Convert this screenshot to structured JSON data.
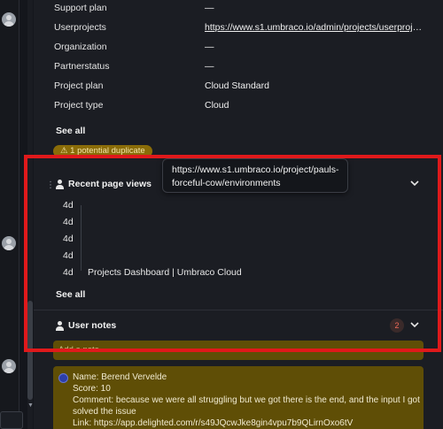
{
  "details": {
    "rows": [
      {
        "label": "Support plan",
        "value": "—"
      },
      {
        "label": "Userprojects",
        "value": "https://www.s1.umbraco.io/admin/projects/userprojects..."
      },
      {
        "label": "Organization",
        "value": "—"
      },
      {
        "label": "Partnerstatus",
        "value": "—"
      },
      {
        "label": "Project plan",
        "value": "Cloud Standard"
      },
      {
        "label": "Project type",
        "value": "Cloud"
      }
    ],
    "see_all": "See all",
    "duplicate_badge": "1 potential duplicate"
  },
  "recent_page_views": {
    "title": "Recent page views",
    "times": [
      "4d",
      "4d",
      "4d",
      "4d",
      "4d"
    ],
    "last_page_title": "Projects Dashboard | Umbraco Cloud",
    "see_all": "See all",
    "tooltip": "https://www.s1.umbraco.io/project/pauls-forceful-cow/environments"
  },
  "user_notes": {
    "title": "User notes",
    "count": "2",
    "add_note_label": "Add a note",
    "note": {
      "name": "Name: Berend Vervelde",
      "score": "Score: 10",
      "comment_line1": "Comment: because we were all struggling but we got there is the end, and the input I got",
      "comment_line2": "solved the issue",
      "link": "Link: https://app.delighted.com/r/s49JQcwJke8gin4vpu7b9QLirnOxo6tV"
    }
  },
  "colors": {
    "highlight": "#e0191b",
    "note_bg": "#5f4e06",
    "badge_bg": "#8a6c08"
  }
}
